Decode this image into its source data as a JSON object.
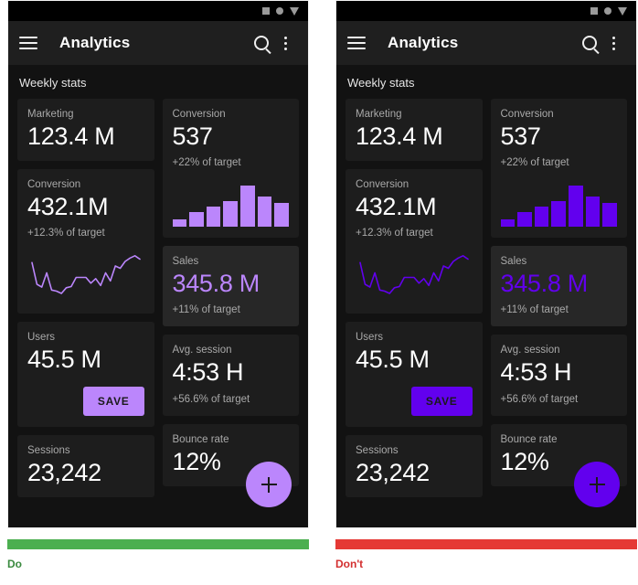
{
  "status_bar": {
    "icons": [
      "square-icon",
      "circle-icon",
      "triangle-down-icon"
    ]
  },
  "app_bar": {
    "menu_icon": "hamburger-menu-icon",
    "title": "Analytics",
    "search_icon": "search-icon",
    "overflow_icon": "more-vert-icon"
  },
  "section_title": "Weekly stats",
  "cards": {
    "marketing": {
      "label": "Marketing",
      "value": "123.4 M"
    },
    "conversion_1": {
      "label": "Conversion",
      "value": "537",
      "sub": "+22% of target"
    },
    "conversion_2": {
      "label": "Conversion",
      "value": "432.1M",
      "sub": "+12.3% of target"
    },
    "sales": {
      "label": "Sales",
      "value": "345.8 M",
      "sub": "+11% of target"
    },
    "users": {
      "label": "Users",
      "value": "45.5 M",
      "save_label": "SAVE"
    },
    "avg_session": {
      "label": "Avg. session",
      "value": "4:53 H",
      "sub": "+56.6% of target"
    },
    "sessions": {
      "label": "Sessions",
      "value": "23,242"
    },
    "bounce_rate": {
      "label": "Bounce rate",
      "value": "12%"
    }
  },
  "fab": {
    "icon": "plus-icon"
  },
  "chart_data": [
    {
      "type": "bar",
      "title": "Conversion weekly bars",
      "categories": [
        "1",
        "2",
        "3",
        "4",
        "5",
        "6",
        "7"
      ],
      "values": [
        8,
        16,
        22,
        28,
        45,
        33,
        26
      ],
      "ylim": [
        0,
        50
      ],
      "xlabel": "",
      "ylabel": "",
      "grid": false,
      "legend": "none"
    },
    {
      "type": "line",
      "title": "Conversion sparkline",
      "x": [
        0,
        1,
        2,
        3,
        4,
        5,
        6,
        7,
        8,
        9,
        10,
        11,
        12,
        13,
        14,
        15,
        16,
        17,
        18,
        19,
        20,
        21,
        22
      ],
      "values": [
        62,
        24,
        19,
        44,
        14,
        12,
        8,
        18,
        20,
        36,
        36,
        36,
        26,
        34,
        22,
        44,
        30,
        56,
        52,
        64,
        70,
        74,
        68
      ],
      "ylim": [
        0,
        80
      ],
      "xlabel": "",
      "ylabel": "",
      "grid": false,
      "legend": "none"
    }
  ],
  "examples": [
    {
      "id": "do",
      "accent": "#bb86fc",
      "caption": "Do",
      "rule_color": "#4caf50"
    },
    {
      "id": "dont",
      "accent": "#6200ee",
      "caption": "Don't",
      "rule_color": "#e53935"
    }
  ]
}
